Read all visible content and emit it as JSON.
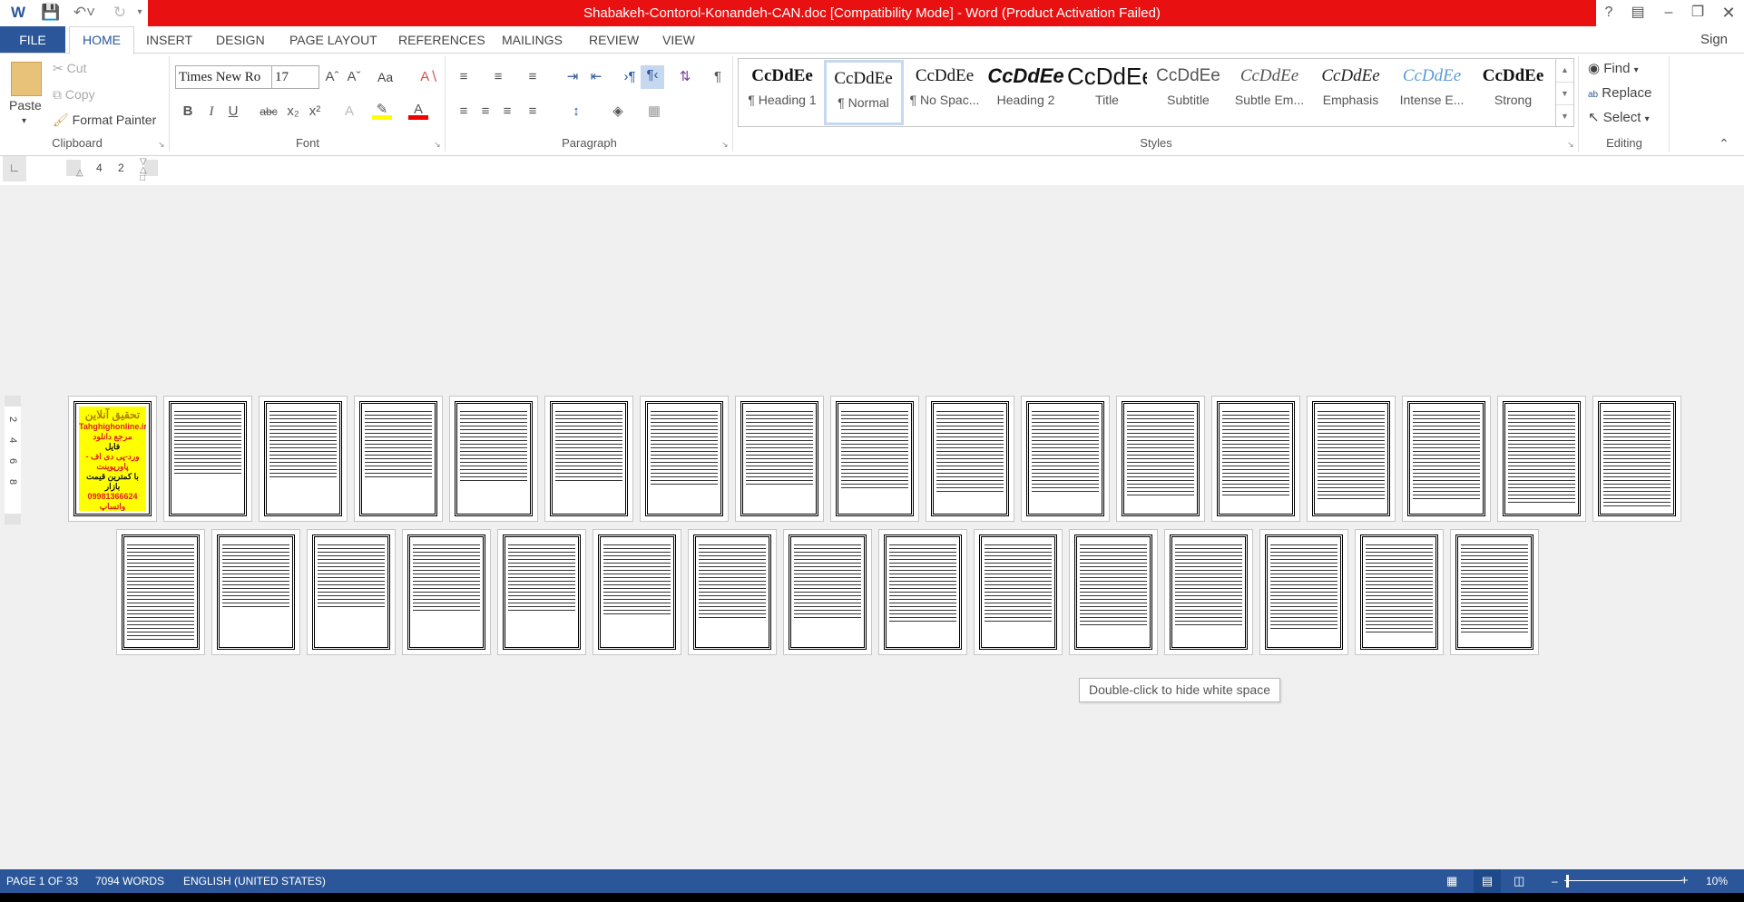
{
  "window": {
    "title": "Shabakeh-Contorol-Konandeh-CAN.doc [Compatibility Mode] -  Word (Product Activation Failed)",
    "help": "?",
    "sign_in": "Sign in",
    "accent": "#2b579a",
    "title_bg": "#e81010"
  },
  "tabs": [
    {
      "label": "FILE"
    },
    {
      "label": "HOME"
    },
    {
      "label": "INSERT"
    },
    {
      "label": "DESIGN"
    },
    {
      "label": "PAGE LAYOUT"
    },
    {
      "label": "REFERENCES"
    },
    {
      "label": "MAILINGS"
    },
    {
      "label": "REVIEW"
    },
    {
      "label": "VIEW"
    }
  ],
  "clipboard": {
    "label": "Clipboard",
    "paste": "Paste",
    "cut": "Cut",
    "copy": "Copy",
    "format_painter": "Format Painter"
  },
  "font": {
    "label": "Font",
    "name": "Times New Ro",
    "size": "17",
    "case": "Aa"
  },
  "paragraph": {
    "label": "Paragraph"
  },
  "styles": {
    "label": "Styles",
    "items": [
      {
        "preview": "CcDdEe",
        "name": "¶ Heading 1"
      },
      {
        "preview": "CcDdEe",
        "name": "¶ Normal"
      },
      {
        "preview": "CcDdEe",
        "name": "¶ No Spac..."
      },
      {
        "preview": "CcDdEe",
        "name": "Heading 2"
      },
      {
        "preview": "CcDdEe",
        "name": "Title"
      },
      {
        "preview": "CcDdEe",
        "name": "Subtitle"
      },
      {
        "preview": "CcDdEe",
        "name": "Subtle Em..."
      },
      {
        "preview": "CcDdEe",
        "name": "Emphasis"
      },
      {
        "preview": "CcDdEe",
        "name": "Intense E..."
      },
      {
        "preview": "CcDdEe",
        "name": "Strong"
      }
    ]
  },
  "editing": {
    "label": "Editing",
    "find": "Find",
    "replace": "Replace",
    "select": "Select"
  },
  "ruler": {
    "h_marks": [
      "4",
      "2"
    ],
    "v_marks": [
      "2",
      "4",
      "6",
      "8"
    ]
  },
  "cover": {
    "lines": [
      "تحقیق آنلاین",
      "Tahghighonline.ir",
      "مرجع دانلود",
      "فایل",
      "ورد-پی دی اف - پاورپوینت",
      "با کمترین قیمت بازار",
      "09981366624 واتساپ"
    ]
  },
  "tooltip": "Double-click to hide white space",
  "status": {
    "page": "PAGE 1 OF 33",
    "words": "7094 WORDS",
    "language": "ENGLISH (UNITED STATES)",
    "zoom": "10%"
  }
}
